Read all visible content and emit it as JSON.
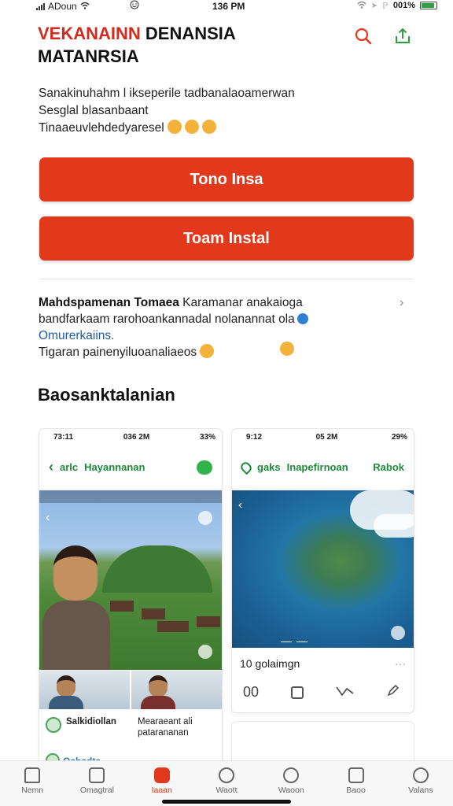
{
  "status_bar": {
    "carrier": "ADoun",
    "time": "136 PM",
    "battery_text": "001%"
  },
  "header": {
    "title_accent": "VEKANAINN",
    "title_rest": " DENANSIA",
    "title_line2": "MATANRSIA",
    "search_icon": "search-icon",
    "share_icon": "share-icon"
  },
  "description": {
    "line1": "Sanakinuhahm l ikseperile tadbanalaoamerwan",
    "line2": "Sesglal blasanbaant",
    "line3": "Tinaaeuvlehdedyaresel"
  },
  "buttons": {
    "primary": "Tono Insa",
    "secondary": "Toam Instal"
  },
  "info": {
    "line1_bold": "Mahdspamenan Tomaea",
    "line1_rest": " Karamanar anakaioga",
    "line2": "bandfarkaam rarohoankannadal nolanannat ola",
    "line3": "Omurerkaiins.",
    "line4": "Tigaran painenyiluoanaliaeos"
  },
  "section": {
    "title": "Baosanktalanian"
  },
  "screenshot1": {
    "status_time": "73:11",
    "status_mid": "036 2M",
    "status_batt": "33%",
    "nav_left": "arlc",
    "nav_title": "Hayannanan",
    "row1_label": "Salkidiollan",
    "row2_label": "Mearaeant ali",
    "row2_sub": "patarananan",
    "row3_label": "Qahadta"
  },
  "screenshot2": {
    "status_time": "9:12",
    "status_mid": "05 2M",
    "status_batt": "29%",
    "nav_left": "gaks",
    "nav_title": "Inapefirnoan",
    "nav_right": "Rabok",
    "caption": "10 golaimgn",
    "more": "···",
    "tool1": "00"
  },
  "tabs": [
    {
      "label": "Nemn"
    },
    {
      "label": "Omagtral"
    },
    {
      "label": "Iaaan"
    },
    {
      "label": "Waott"
    },
    {
      "label": "Waoon"
    },
    {
      "label": "Baoo"
    },
    {
      "label": "Valans"
    }
  ],
  "colors": {
    "accent": "#e2391c",
    "title_red": "#d52b1e",
    "nav_green": "#1f8a3b"
  }
}
